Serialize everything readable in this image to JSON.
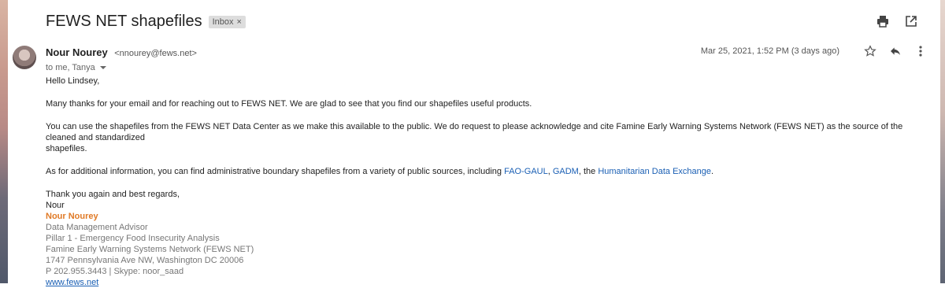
{
  "email": {
    "subject": "FEWS NET shapefiles",
    "label": "Inbox",
    "label_remove": "×",
    "sender_name": "Nour Nourey",
    "sender_email": "<nnourey@fews.net>",
    "to_line": "to me, Tanya",
    "date": "Mar 25, 2021, 1:52 PM (3 days ago)"
  },
  "icons": {
    "print": "printer-icon",
    "new_window": "open-in-new-window-icon",
    "star": "star-icon",
    "reply": "reply-icon",
    "more": "more-vertical-icon"
  },
  "body": {
    "greeting": "Hello Lindsey,",
    "p1": "Many thanks for your email and for reaching out to FEWS NET. We are glad to see that you find our shapefiles useful products.",
    "p2_line1": "You can use the shapefiles from the FEWS NET Data Center as we make this available to the public. We do request to please acknowledge and cite Famine Early Warning Systems Network (FEWS NET) as the source of the cleaned and standardized",
    "p2_line2": "shapefiles.",
    "p3_prefix": "As for additional information, you can find administrative boundary shapefiles from a variety of public sources, including",
    "link_fao": "FAO-GAUL",
    "sep1": ",",
    "link_gadm": "GADM",
    "sep2": ", the",
    "link_hdx": "Humanitarian Data Exchange",
    "end": ".",
    "closing": "Thank you again and best regards,",
    "closing_name": "Nour"
  },
  "signature": {
    "name": "Nour Nourey",
    "title": "Data Management Advisor",
    "pillar": "Pillar 1 - Emergency Food Insecurity Analysis",
    "org": "Famine Early Warning Systems Network (FEWS NET)",
    "address": "1747 Pennsylvania Ave NW, Washington DC 20006",
    "phone": "P 202.955.3443 | Skype: noor_saad",
    "website": "www.fews.net"
  },
  "colors": {
    "link": "#1a5fb4",
    "signature_name": "#e07a26"
  }
}
